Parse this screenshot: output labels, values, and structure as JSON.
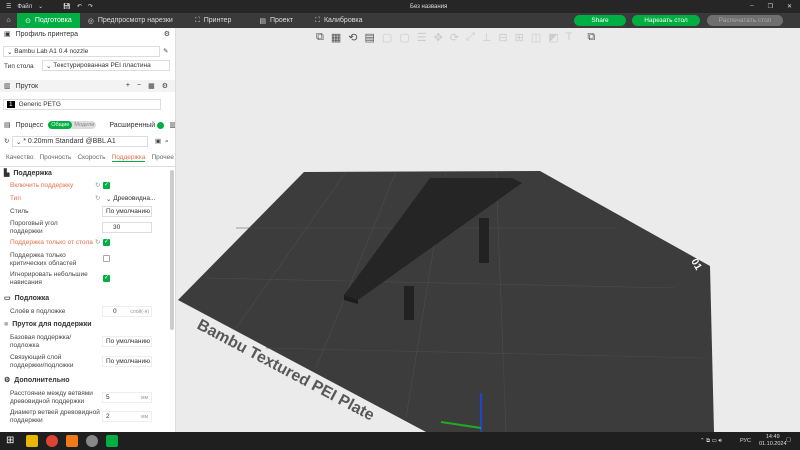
{
  "titlebar": {
    "file_menu": "Файл",
    "title": "Без названия"
  },
  "tabs": [
    {
      "label": "Подготовка"
    },
    {
      "label": "Предпросмотр нарезки"
    },
    {
      "label": "Принтер"
    },
    {
      "label": "Проект"
    },
    {
      "label": "Калибровка"
    }
  ],
  "actions": {
    "share": "Share",
    "slice": "Нарезать стол",
    "print": "Распечатать стол"
  },
  "printer": {
    "section": "Профиль принтера",
    "name": "Bambu Lab A1 0.4 nozzle",
    "bed_label": "Тип стола",
    "bed_value": "Текстурированная PEI пластина"
  },
  "filament": {
    "section": "Пруток",
    "slot": "1",
    "name": "Generic PETG"
  },
  "process": {
    "section": "Процесс",
    "toggle_global": "Общие",
    "toggle_objects": "Модели",
    "advanced": "Расширенный",
    "preset": "* 0.20mm Standard @BBL A1"
  },
  "subtabs": [
    {
      "label": "Качество"
    },
    {
      "label": "Прочность"
    },
    {
      "label": "Скорость"
    },
    {
      "label": "Поддержка"
    },
    {
      "label": "Прочее"
    }
  ],
  "support": {
    "group": "Поддержка",
    "enable": "Включить поддержку",
    "type_label": "Тип",
    "type_value": "Древовидна...",
    "style_label": "Стиль",
    "style_value": "По умолчанию",
    "angle_label": "Пороговый угол поддержки",
    "angle_value": "30",
    "build_plate_only": "Поддержка только от стола",
    "critical_only": "Поддержка только критических областей",
    "ignore_small": "Игнорировать небольшие нависания"
  },
  "raft": {
    "group": "Подложка",
    "layers_label": "Слоёв в подложке",
    "layers_value": "0",
    "layers_unit": "слой(-я)"
  },
  "support_filament": {
    "group": "Пруток для поддержки",
    "base_label": "Базовая поддержка/подложка",
    "base_value": "По умолчанию",
    "interface_label": "Связующий слой поддержки/подложки",
    "interface_value": "По умолчанию"
  },
  "advanced": {
    "group": "Дополнительно",
    "branch_dist_label": "Расстояние между ветвями древовидной поддержки",
    "branch_dist_value": "5",
    "branch_diam_label": "Диаметр ветвей древовидной поддержки",
    "branch_diam_value": "2",
    "unit": "мм"
  },
  "plate": {
    "label": "Bambu Textured PEI Plate",
    "number": "01"
  },
  "taskbar": {
    "lang": "РУС",
    "time": "14:49",
    "date": "01.10.2024"
  },
  "colors": {
    "accent": "#00ae42",
    "warn": "#e5704d"
  }
}
